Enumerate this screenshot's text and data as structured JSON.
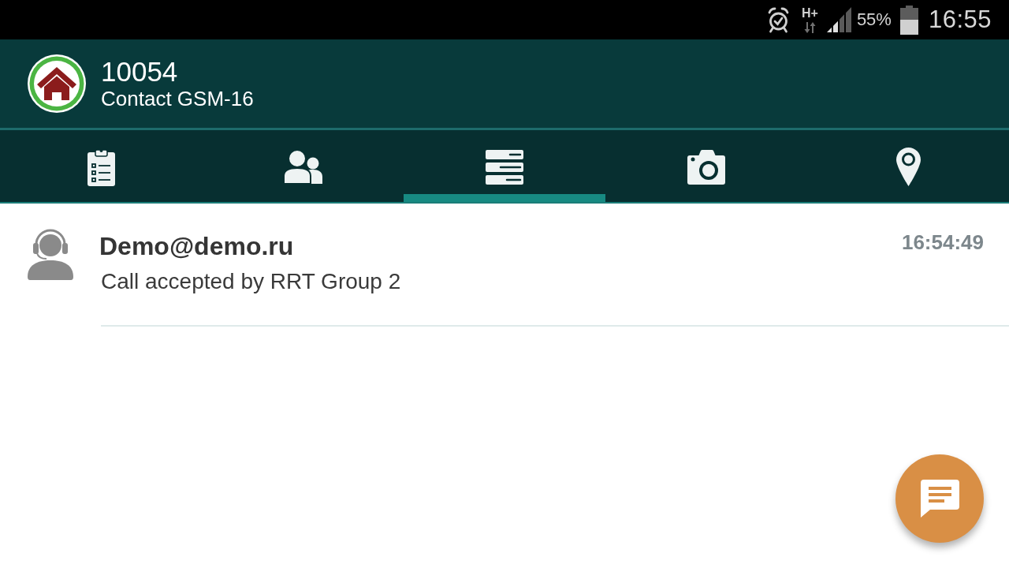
{
  "status_bar": {
    "network": "H+",
    "battery": "55%",
    "time": "16:55"
  },
  "header": {
    "title": "10054",
    "subtitle": "Contact GSM-16"
  },
  "tabs": [
    {
      "kind": "checklist",
      "selected": false
    },
    {
      "kind": "contacts",
      "selected": false
    },
    {
      "kind": "list",
      "selected": true
    },
    {
      "kind": "camera",
      "selected": false
    },
    {
      "kind": "location",
      "selected": false
    }
  ],
  "messages": [
    {
      "sender": "Demo@demo.ru",
      "text": "Call accepted by RRT Group 2",
      "time": "16:54:49"
    }
  ]
}
